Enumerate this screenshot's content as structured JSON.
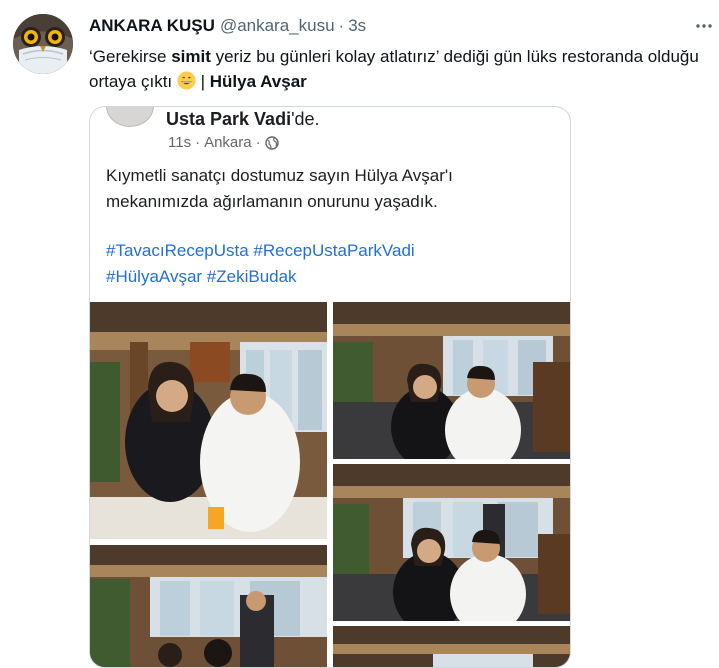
{
  "tweet": {
    "author_name": "ANKARA KUŞU",
    "author_handle": "@ankara_kusu",
    "separator": "·",
    "time": "3s",
    "text_part1": "‘Gerekirse ",
    "text_bold1": "simit",
    "text_part2": " yeriz bu günleri kolay atlatırız’ dediği gün lüks restoranda olduğu ortaya çıktı ",
    "text_part3": " | ",
    "text_bold2": "Hülya Avşar",
    "more_icon": "more-horizontal-icon"
  },
  "embedded_post": {
    "place_name": "Usta Park Vadi",
    "place_suffix": "'de.",
    "time": "11s",
    "separator": "·",
    "location": "Ankara",
    "separator2": "·",
    "privacy_icon": "globe-icon",
    "text_line1": "Kıymetli sanatçı dostumuz sayın Hülya Avşar'ı",
    "text_line2": "mekanımızda ağırlamanın onurunu yaşadık.",
    "tags_line1": "#TavacıRecepUsta #RecepUstaParkVadi",
    "tags_line2": "#HülyaAvşar #ZekiBudak"
  },
  "colors": {
    "link": "#216fdb",
    "secondary": "#536471",
    "border": "#cfd9de"
  }
}
